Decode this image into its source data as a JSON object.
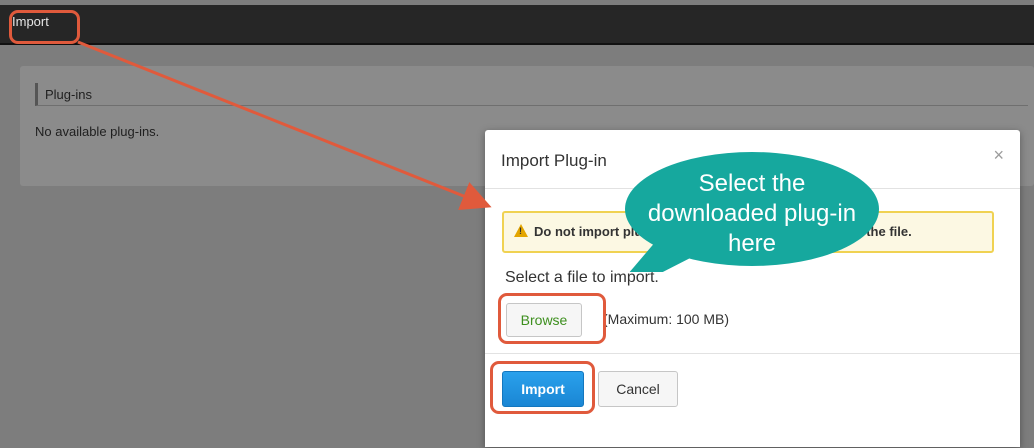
{
  "topbar": {
    "tab_label": "Import"
  },
  "panel": {
    "title": "Plug-ins",
    "empty_text": "No available plug-ins."
  },
  "modal": {
    "title": "Import Plug-in",
    "close_glyph": "×",
    "warning_text": "Do not import plug-ins unless you trust the source of the file.",
    "file_label": "Select a file to import.",
    "browse_label": "Browse",
    "max_size_text": "(Maximum: 100 MB)",
    "import_label": "Import",
    "cancel_label": "Cancel"
  },
  "annotation": {
    "callout_line1": "Select the",
    "callout_line2": "downloaded plug-in",
    "callout_line3": "here"
  },
  "colors": {
    "highlight": "#e05a3c",
    "callout": "#16a89e",
    "primary_button": "#1a86d4",
    "warning_border": "#f0d252"
  },
  "icons": {
    "warning": "warning-triangle-icon",
    "close": "close-icon"
  }
}
